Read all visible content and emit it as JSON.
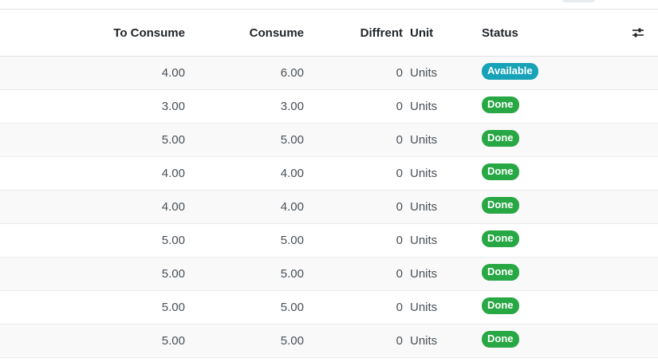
{
  "columns": {
    "to_consume": "To Consume",
    "consume": "Consume",
    "diffrent": "Diffrent",
    "unit": "Unit",
    "status": "Status"
  },
  "status_colors": {
    "Available": "#17a2b8",
    "Done": "#28a745"
  },
  "rows": [
    {
      "to_consume": "4.00",
      "consume": "6.00",
      "diffrent": "0",
      "unit": "Units",
      "status": "Available"
    },
    {
      "to_consume": "3.00",
      "consume": "3.00",
      "diffrent": "0",
      "unit": "Units",
      "status": "Done"
    },
    {
      "to_consume": "5.00",
      "consume": "5.00",
      "diffrent": "0",
      "unit": "Units",
      "status": "Done"
    },
    {
      "to_consume": "4.00",
      "consume": "4.00",
      "diffrent": "0",
      "unit": "Units",
      "status": "Done"
    },
    {
      "to_consume": "4.00",
      "consume": "4.00",
      "diffrent": "0",
      "unit": "Units",
      "status": "Done"
    },
    {
      "to_consume": "5.00",
      "consume": "5.00",
      "diffrent": "0",
      "unit": "Units",
      "status": "Done"
    },
    {
      "to_consume": "5.00",
      "consume": "5.00",
      "diffrent": "0",
      "unit": "Units",
      "status": "Done"
    },
    {
      "to_consume": "5.00",
      "consume": "5.00",
      "diffrent": "0",
      "unit": "Units",
      "status": "Done"
    },
    {
      "to_consume": "5.00",
      "consume": "5.00",
      "diffrent": "0",
      "unit": "Units",
      "status": "Done"
    }
  ],
  "icons": {
    "column_settings": "sliders-icon"
  }
}
